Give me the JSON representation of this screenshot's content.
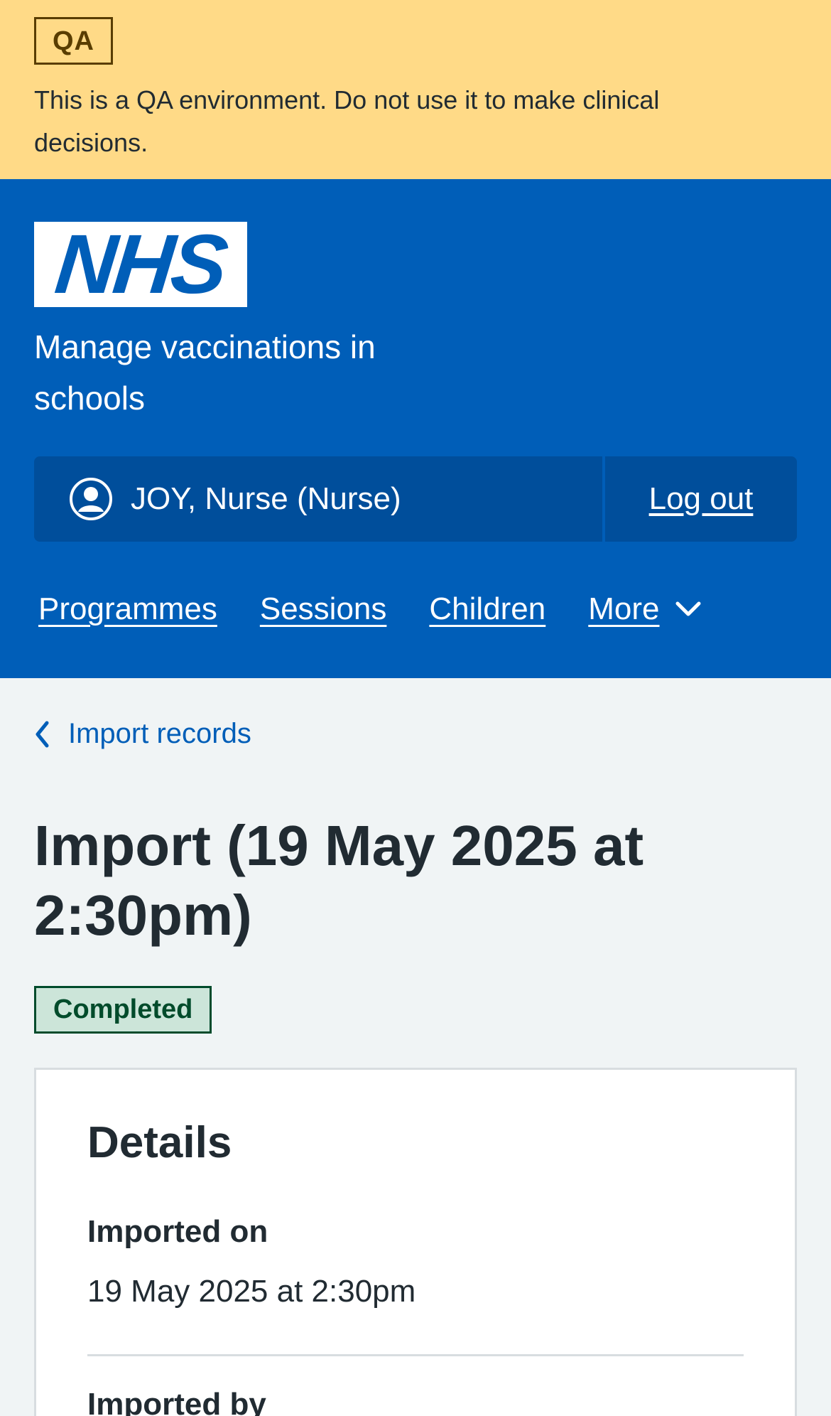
{
  "qa_banner": {
    "tag": "QA",
    "message": "This is a QA environment. Do not use it to make clinical decisions.",
    "background_color": "#ffda87"
  },
  "header": {
    "logo_text": "NHS",
    "service_name": "Manage vaccinations in schools",
    "background_color": "#005eb8",
    "account": {
      "icon": "user-circle-icon",
      "user_label": "JOY, Nurse (Nurse)",
      "logout_label": "Log out"
    },
    "nav": [
      {
        "label": "Programmes"
      },
      {
        "label": "Sessions"
      },
      {
        "label": "Children"
      },
      {
        "label": "More",
        "icon": "chevron-down-icon"
      }
    ]
  },
  "main": {
    "back_link": {
      "label": "Import records",
      "icon": "chevron-left-icon"
    },
    "title": "Import (19 May 2025 at 2:30pm)",
    "status": {
      "label": "Completed",
      "color": "#004b2b"
    },
    "details": {
      "heading": "Details",
      "rows": [
        {
          "key": "Imported on",
          "value": "19 May 2025 at 2:30pm"
        },
        {
          "key": "Imported by"
        }
      ]
    }
  }
}
